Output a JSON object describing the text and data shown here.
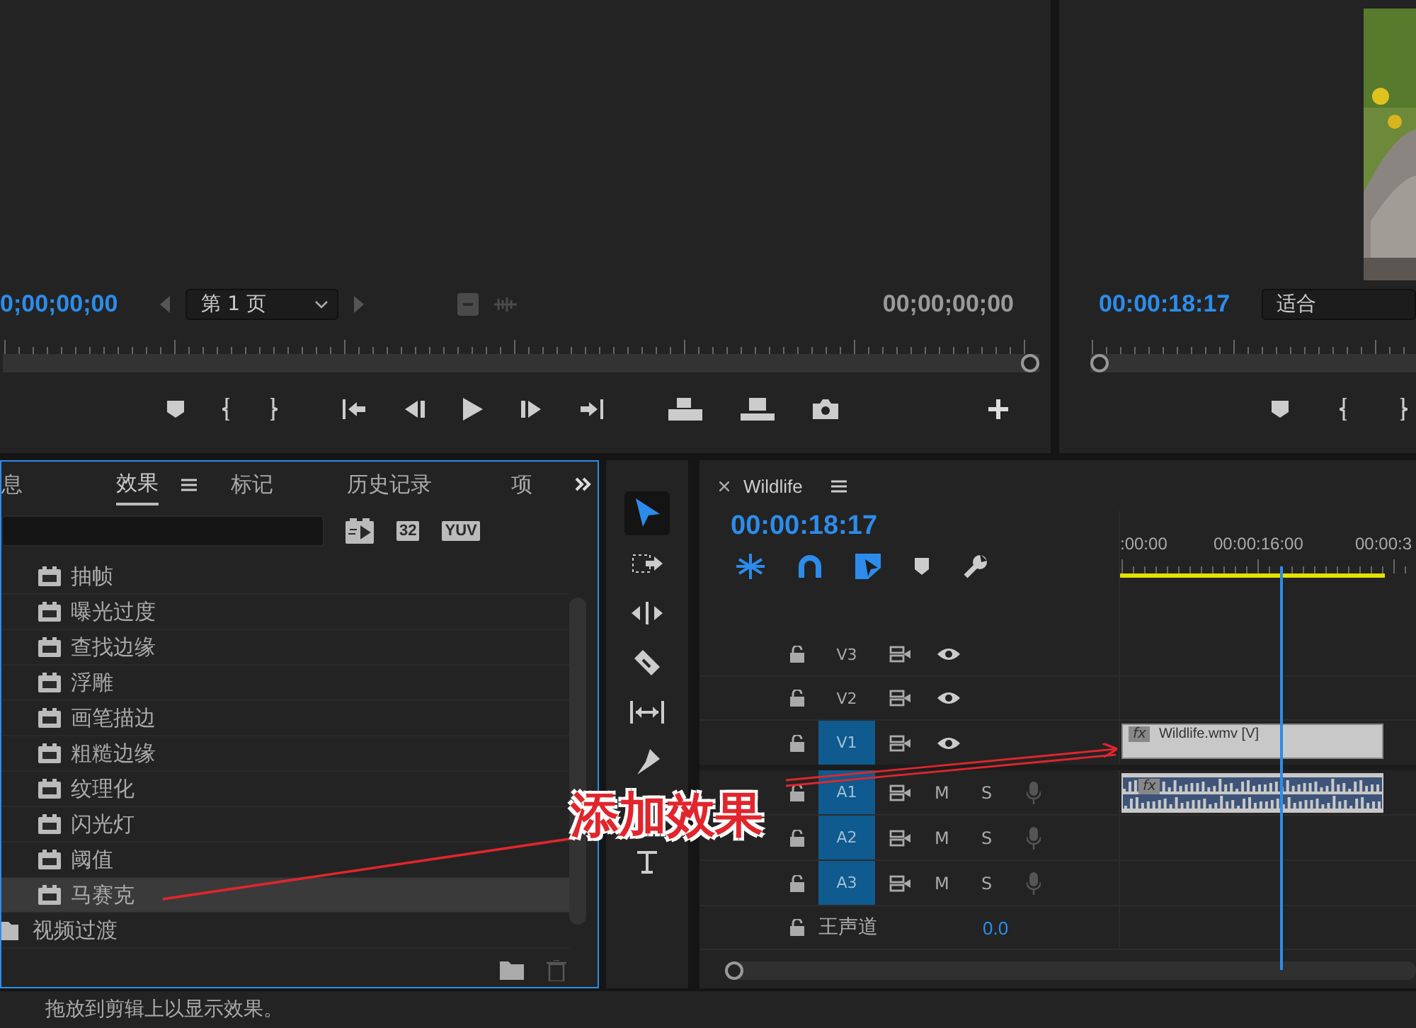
{
  "source_monitor": {
    "timecode_left": "0;00;00;00",
    "page_select": "第 1 页",
    "timecode_right": "00;00;00;00"
  },
  "program_monitor": {
    "timecode": "00:00:18:17",
    "zoom_select": "适合"
  },
  "effects_panel": {
    "tabs": [
      {
        "label": "息",
        "selected": false
      },
      {
        "label": "效果",
        "selected": true
      },
      {
        "label": "标记",
        "selected": false
      },
      {
        "label": "历史记录",
        "selected": false
      },
      {
        "label": "项",
        "selected": false
      }
    ],
    "badges": [
      {
        "kind": "accelerated"
      },
      {
        "kind": "text",
        "label": "32"
      },
      {
        "kind": "text",
        "label": "YUV"
      }
    ],
    "items": [
      {
        "label": "抽帧",
        "selected": false
      },
      {
        "label": "曝光过度",
        "selected": false
      },
      {
        "label": "查找边缘",
        "selected": false
      },
      {
        "label": "浮雕",
        "selected": false
      },
      {
        "label": "画笔描边",
        "selected": false
      },
      {
        "label": "粗糙边缘",
        "selected": false
      },
      {
        "label": "纹理化",
        "selected": false
      },
      {
        "label": "闪光灯",
        "selected": false
      },
      {
        "label": "阈值",
        "selected": false
      },
      {
        "label": "马赛克",
        "selected": true
      }
    ],
    "folder": "视频过渡"
  },
  "tools": [
    {
      "kind": "selection",
      "selected": true
    },
    {
      "kind": "track-select",
      "selected": false
    },
    {
      "kind": "ripple",
      "selected": false
    },
    {
      "kind": "razor",
      "selected": false
    },
    {
      "kind": "slip",
      "selected": false
    },
    {
      "kind": "pen",
      "selected": false
    },
    {
      "kind": "type",
      "selected": false
    }
  ],
  "timeline": {
    "title": "Wildlife",
    "timecode": "00:00:18:17",
    "ruler_labels": [
      ":00:00",
      "00:00:16:00",
      "00:00:3"
    ],
    "tracks": [
      {
        "name": "V3",
        "kind": "video",
        "targeted": false
      },
      {
        "name": "V2",
        "kind": "video",
        "targeted": false
      },
      {
        "name": "V1",
        "kind": "video",
        "targeted": true,
        "clip": {
          "badge": "fx",
          "label": "Wildlife.wmv [V]"
        }
      },
      {
        "name": "A1",
        "kind": "audio",
        "targeted": true,
        "mute": "M",
        "solo": "S",
        "clip": {
          "badge": "fx"
        }
      },
      {
        "name": "A2",
        "kind": "audio",
        "targeted": true,
        "mute": "M",
        "solo": "S"
      },
      {
        "name": "A3",
        "kind": "audio",
        "targeted": true,
        "mute": "M",
        "solo": "S"
      }
    ],
    "master": {
      "label": "王声道",
      "value": "0.0"
    }
  },
  "annotation": {
    "text": "添加效果"
  },
  "status_bar": {
    "text": "拖放到剪辑上以显示效果。"
  }
}
